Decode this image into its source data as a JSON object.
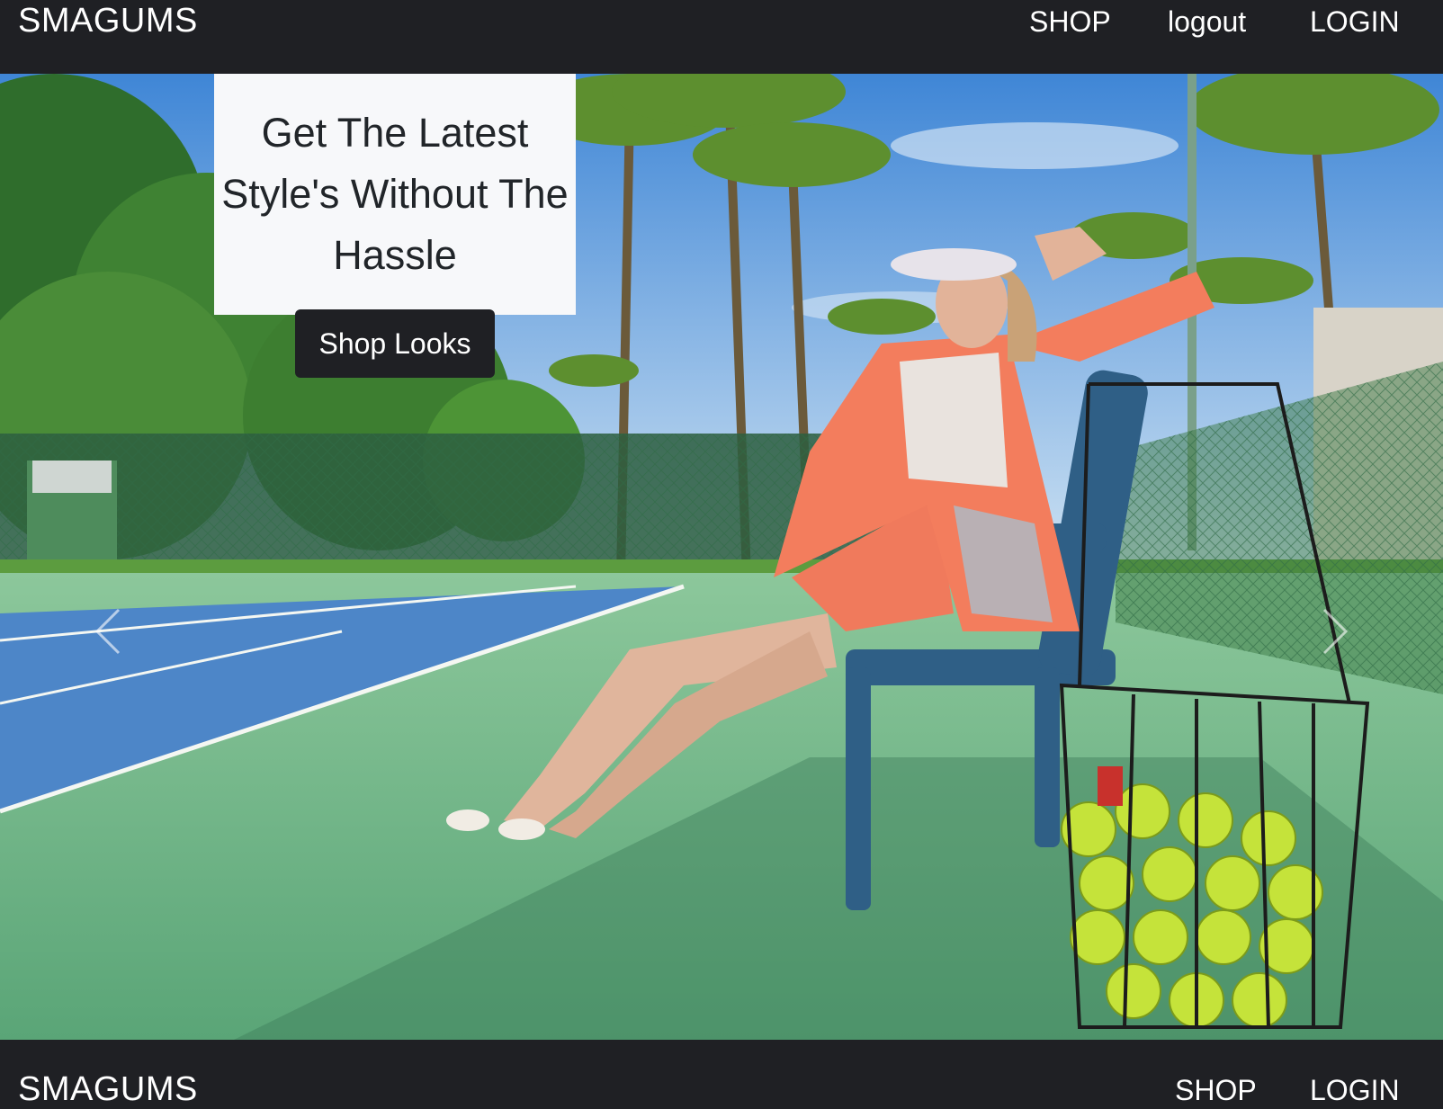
{
  "header": {
    "brand": "SMAGUMS",
    "links": {
      "shop": "SHOP",
      "logout": "logout",
      "login": "LOGIN"
    }
  },
  "hero": {
    "heading": "Get The Latest Style's Without The Hassle",
    "button_label": "Shop Looks",
    "prev_icon": "chevron-left-icon",
    "next_icon": "chevron-right-icon"
  },
  "footer": {
    "brand": "SMAGUMS",
    "links": {
      "shop": "SHOP",
      "login": "LOGIN"
    }
  },
  "colors": {
    "navbar": "#1f2024",
    "caption_bg": "#f7f8fa",
    "caption_text": "#212529",
    "button_bg": "#1f2024"
  }
}
